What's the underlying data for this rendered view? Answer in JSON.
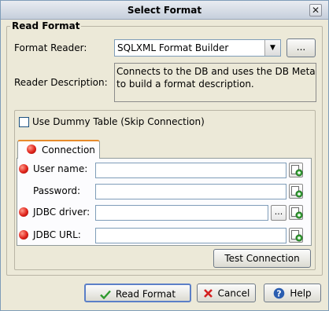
{
  "window": {
    "title": "Select Format",
    "close_glyph": "✕"
  },
  "read_format": {
    "group_title": "Read Format",
    "format_reader_label": "Format Reader:",
    "format_reader_value": "SQLXML Format Builder",
    "browse_label": "...",
    "reader_description_label": "Reader Description:",
    "reader_description_line1": "Connects to the DB and uses the DB MetaData",
    "reader_description_line2": "to build a format description."
  },
  "dummy_table": {
    "label": "Use Dummy Table (Skip Connection)",
    "checked": false
  },
  "connection_tab": {
    "label": "Connection",
    "fields": {
      "user_name": {
        "label": "User name:",
        "value": "",
        "required": true
      },
      "password": {
        "label": "Password:",
        "value": "",
        "required": false
      },
      "jdbc_driver": {
        "label": "JDBC driver:",
        "value": "",
        "required": true,
        "browse_label": "..."
      },
      "jdbc_url": {
        "label": "JDBC URL:",
        "value": "",
        "required": true
      }
    },
    "test_connection_label": "Test Connection"
  },
  "buttons": {
    "read_format_label": "Read Format",
    "cancel_label": "Cancel",
    "help_label": "Help"
  },
  "colors": {
    "dialog_bg": "#ece9d8",
    "required_marker": "#e0231b",
    "tab_highlight": "#e68b2c",
    "ok_green": "#2e9a2e",
    "cancel_red": "#d42020",
    "help_blue": "#2a5db0"
  },
  "icons": {
    "close": "close-icon",
    "combo_arrow": "chevron-down-icon",
    "required": "required-dot-icon",
    "add": "add-variable-icon",
    "ok": "checkmark-icon",
    "cancel": "x-icon",
    "help": "help-icon"
  }
}
